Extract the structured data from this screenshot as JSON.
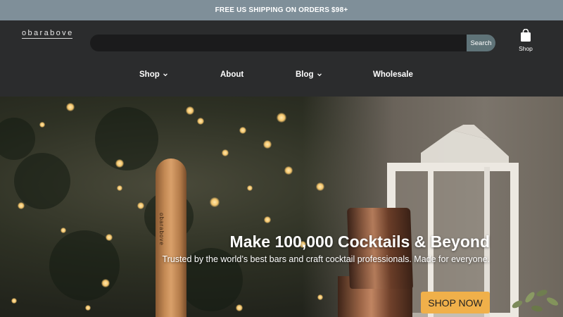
{
  "announcement": {
    "text": "FREE US SHIPPING ON ORDERS $98+"
  },
  "header": {
    "logo_text": "obarabove",
    "search": {
      "placeholder": "",
      "button_label": "Search"
    },
    "cart": {
      "label": "Shop",
      "icon": "shopping-bag-icon"
    },
    "nav": [
      {
        "label": "Shop",
        "has_dropdown": true
      },
      {
        "label": "About",
        "has_dropdown": false
      },
      {
        "label": "Blog",
        "has_dropdown": true
      },
      {
        "label": "Wholesale",
        "has_dropdown": false
      }
    ]
  },
  "hero": {
    "headline": "Make 100,000 Cocktails & Beyond",
    "subline": "Trusted by the world’s best bars and craft cocktail professionals. Made for everyone.",
    "cta_label": "SHOP NOW",
    "muddler_engraving": "obarabove"
  },
  "colors": {
    "announcement_bg": "#7f8f99",
    "header_bg": "#2b2c2d",
    "search_button": "#5f7378",
    "cta": "#f0b04a"
  }
}
